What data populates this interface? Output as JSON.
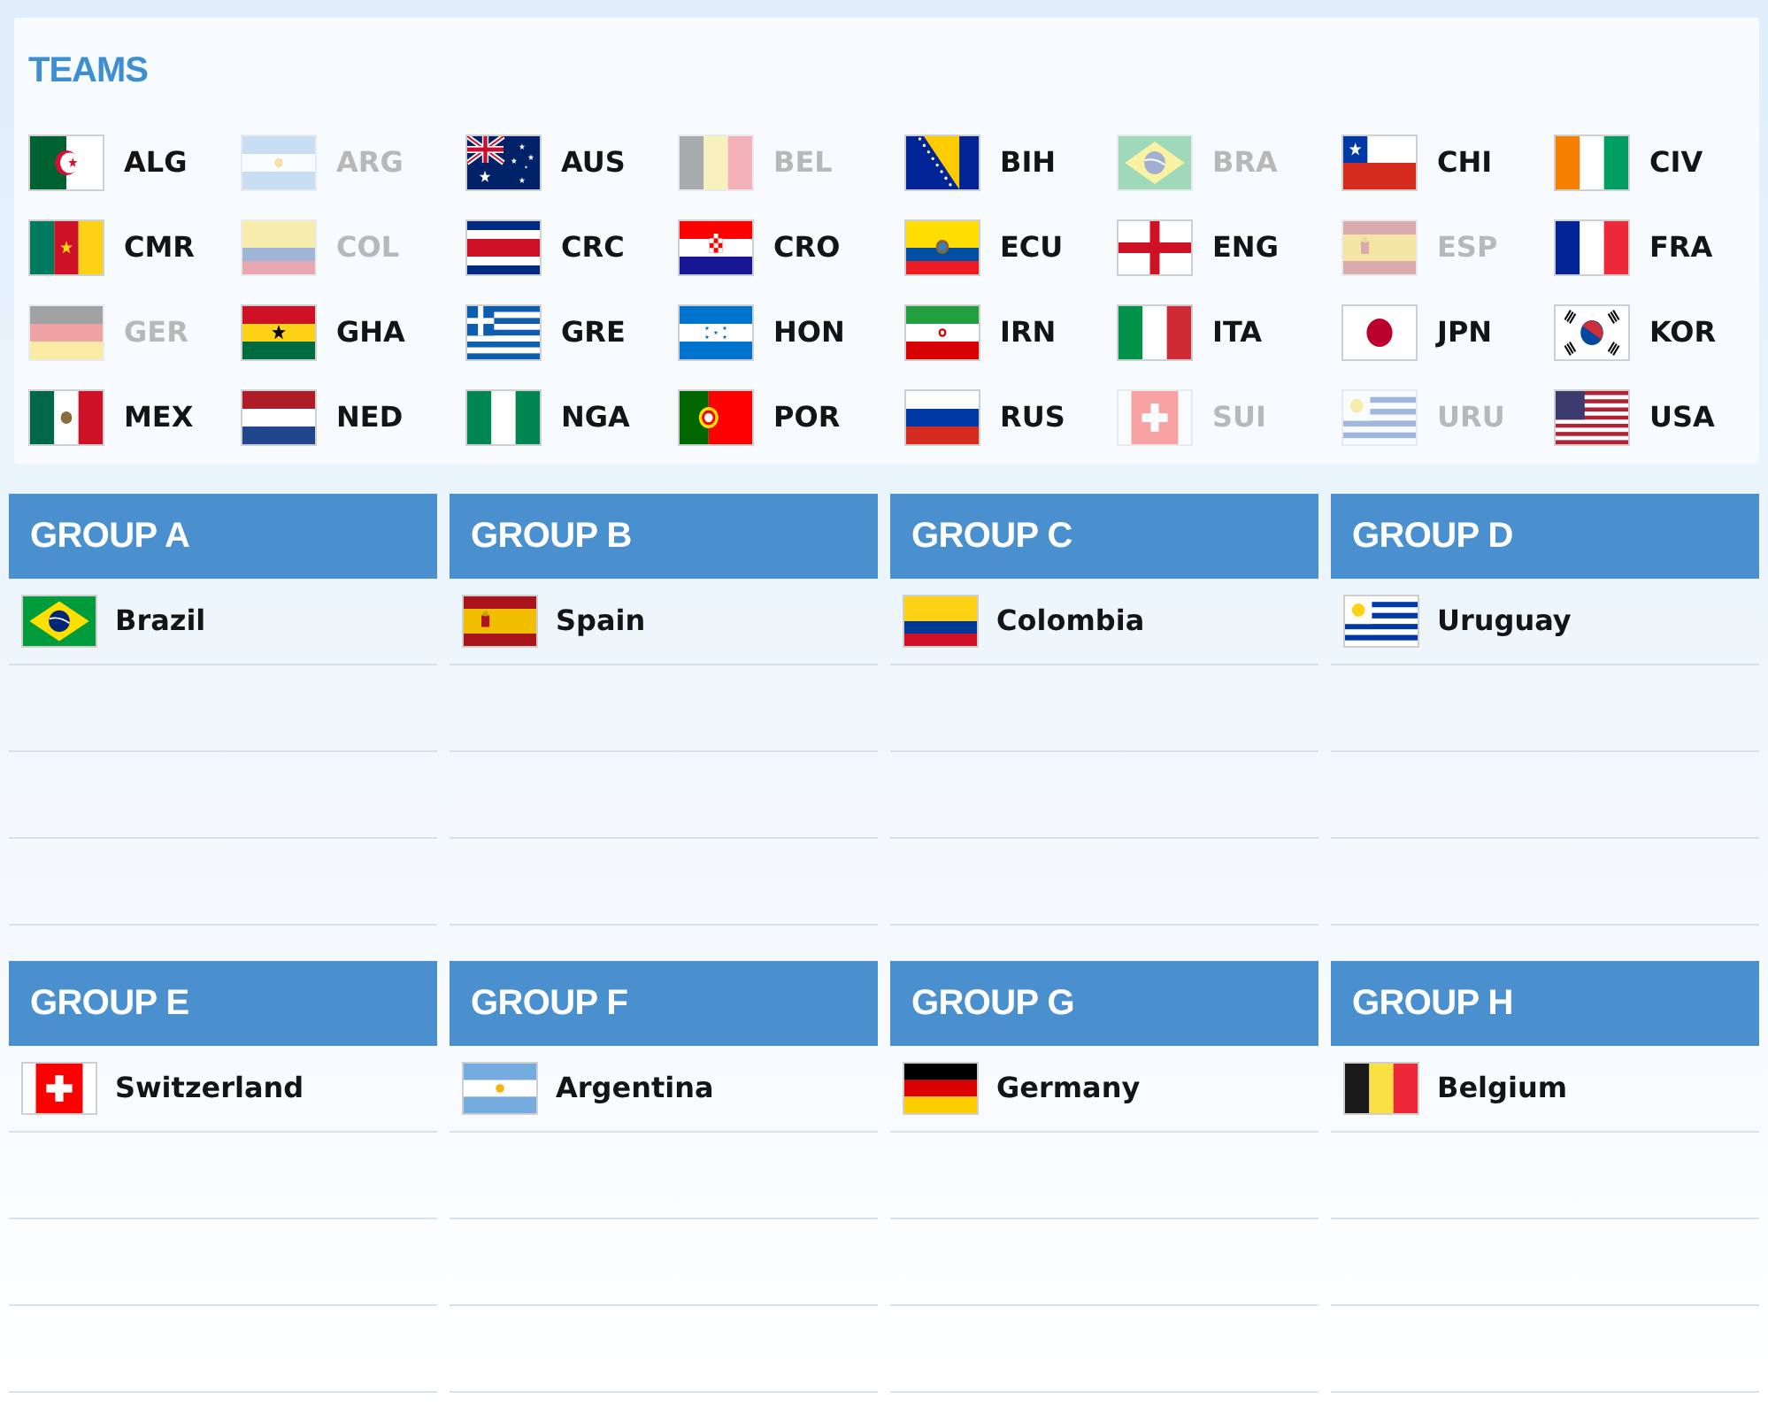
{
  "teams_panel": {
    "title": "TEAMS",
    "teams": [
      {
        "code": "ALG",
        "kind": "algeria",
        "placed": false
      },
      {
        "code": "ARG",
        "kind": "argentina",
        "placed": true
      },
      {
        "code": "AUS",
        "kind": "australia",
        "placed": false
      },
      {
        "code": "BEL",
        "kind": "belgium",
        "placed": true
      },
      {
        "code": "BIH",
        "kind": "bosnia",
        "placed": false
      },
      {
        "code": "BRA",
        "kind": "brazil",
        "placed": true
      },
      {
        "code": "CHI",
        "kind": "chile",
        "placed": false
      },
      {
        "code": "CIV",
        "kind": "ivorycoast",
        "placed": false
      },
      {
        "code": "CMR",
        "kind": "cameroon",
        "placed": false
      },
      {
        "code": "COL",
        "kind": "colombia",
        "placed": true
      },
      {
        "code": "CRC",
        "kind": "costarica",
        "placed": false
      },
      {
        "code": "CRO",
        "kind": "croatia",
        "placed": false
      },
      {
        "code": "ECU",
        "kind": "ecuador",
        "placed": false
      },
      {
        "code": "ENG",
        "kind": "england",
        "placed": false
      },
      {
        "code": "ESP",
        "kind": "spain",
        "placed": true
      },
      {
        "code": "FRA",
        "kind": "france",
        "placed": false
      },
      {
        "code": "GER",
        "kind": "germany",
        "placed": true
      },
      {
        "code": "GHA",
        "kind": "ghana",
        "placed": false
      },
      {
        "code": "GRE",
        "kind": "greece",
        "placed": false
      },
      {
        "code": "HON",
        "kind": "honduras",
        "placed": false
      },
      {
        "code": "IRN",
        "kind": "iran",
        "placed": false
      },
      {
        "code": "ITA",
        "kind": "italy",
        "placed": false
      },
      {
        "code": "JPN",
        "kind": "japan",
        "placed": false
      },
      {
        "code": "KOR",
        "kind": "korea",
        "placed": false
      },
      {
        "code": "MEX",
        "kind": "mexico",
        "placed": false
      },
      {
        "code": "NED",
        "kind": "netherlands",
        "placed": false
      },
      {
        "code": "NGA",
        "kind": "nigeria",
        "placed": false
      },
      {
        "code": "POR",
        "kind": "portugal",
        "placed": false
      },
      {
        "code": "RUS",
        "kind": "russia",
        "placed": false
      },
      {
        "code": "SUI",
        "kind": "switzerland",
        "placed": true
      },
      {
        "code": "URU",
        "kind": "uruguay",
        "placed": true
      },
      {
        "code": "USA",
        "kind": "usa",
        "placed": false
      }
    ]
  },
  "groups": [
    {
      "title": "GROUP A",
      "teams": [
        {
          "name": "Brazil",
          "kind": "brazil"
        }
      ]
    },
    {
      "title": "GROUP B",
      "teams": [
        {
          "name": "Spain",
          "kind": "spain"
        }
      ]
    },
    {
      "title": "GROUP C",
      "teams": [
        {
          "name": "Colombia",
          "kind": "colombia"
        }
      ]
    },
    {
      "title": "GROUP D",
      "teams": [
        {
          "name": "Uruguay",
          "kind": "uruguay"
        }
      ]
    },
    {
      "title": "GROUP E",
      "teams": [
        {
          "name": "Switzerland",
          "kind": "switzerland"
        }
      ]
    },
    {
      "title": "GROUP F",
      "teams": [
        {
          "name": "Argentina",
          "kind": "argentina"
        }
      ]
    },
    {
      "title": "GROUP G",
      "teams": [
        {
          "name": "Germany",
          "kind": "germany"
        }
      ]
    },
    {
      "title": "GROUP H",
      "teams": [
        {
          "name": "Belgium",
          "kind": "belgium"
        }
      ]
    }
  ]
}
